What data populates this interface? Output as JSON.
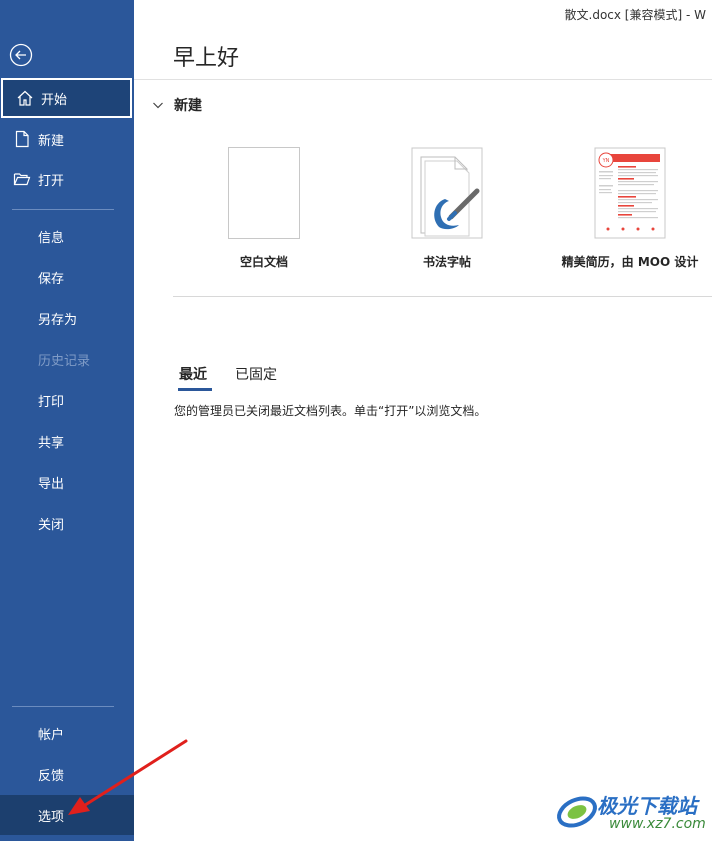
{
  "window": {
    "title": "散文.docx [兼容模式]  -  W"
  },
  "sidebar": {
    "items": [
      {
        "label": "开始",
        "icon": "home-icon",
        "state": "active"
      },
      {
        "label": "新建",
        "icon": "new-document-icon"
      },
      {
        "label": "打开",
        "icon": "folder-open-icon"
      },
      {
        "label": "信息"
      },
      {
        "label": "保存"
      },
      {
        "label": "另存为"
      },
      {
        "label": "历史记录",
        "state": "disabled"
      },
      {
        "label": "打印"
      },
      {
        "label": "共享"
      },
      {
        "label": "导出"
      },
      {
        "label": "关闭"
      },
      {
        "label": "帐户"
      },
      {
        "label": "反馈"
      },
      {
        "label": "选项",
        "state": "selected"
      }
    ]
  },
  "main": {
    "greeting": "早上好",
    "new_section": {
      "title": "新建",
      "templates": [
        {
          "label": "空白文档"
        },
        {
          "label": "书法字帖"
        },
        {
          "label": "精美简历，由 MOO 设计",
          "badge": "YN"
        }
      ]
    },
    "tabs": [
      {
        "label": "最近"
      },
      {
        "label": "已固定"
      }
    ],
    "notice": "您的管理员已关闭最近文档列表。单击“打开”以浏览文档。"
  },
  "watermark": {
    "text": "极光下载站",
    "url": "www.xz7.com"
  },
  "colors": {
    "sidebar": "#2b579a",
    "accent": "#2b579a",
    "arrow": "#e0201c"
  }
}
